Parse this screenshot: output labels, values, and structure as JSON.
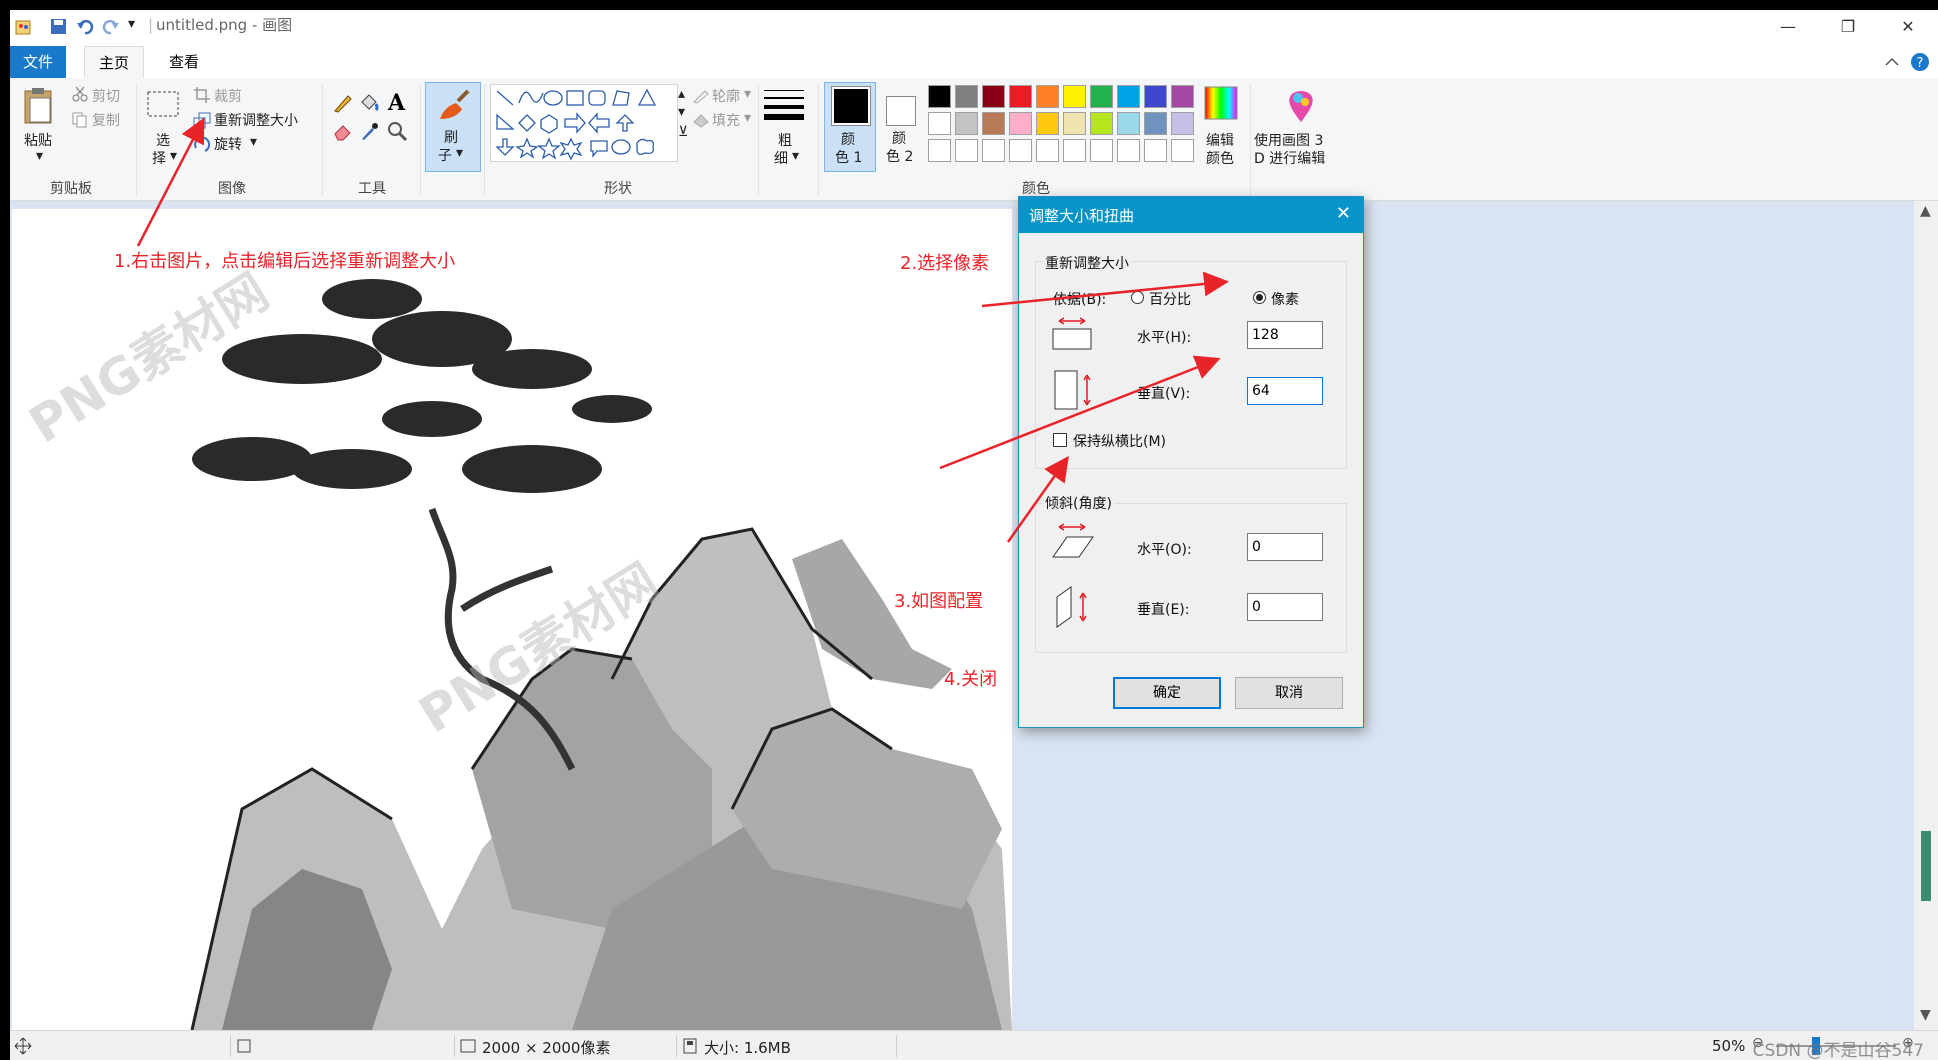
{
  "titlebar": {
    "title": "untitled.png - 画图",
    "qat_dropdown": "▾",
    "minimize": "—",
    "restore": "❐",
    "close": "✕"
  },
  "tabs": {
    "file": "文件",
    "home": "主页",
    "view": "查看"
  },
  "ribbon": {
    "clipboard": {
      "paste": "粘贴",
      "cut": "剪切",
      "copy": "复制",
      "label": "剪贴板"
    },
    "image": {
      "select_line1": "选",
      "select_line2": "择",
      "crop": "裁剪",
      "resize": "重新调整大小",
      "rotate": "旋转",
      "label": "图像"
    },
    "tools": {
      "label": "工具"
    },
    "brushes": {
      "line1": "刷",
      "line2": "子"
    },
    "shapes": {
      "outline": "轮廓",
      "fill": "填充",
      "label": "形状"
    },
    "size": {
      "line1": "粗",
      "line2": "细"
    },
    "color1": {
      "line1": "颜",
      "line2": "色 1"
    },
    "color2": {
      "line1": "颜",
      "line2": "色 2"
    },
    "colors_label": "颜色",
    "edit_colors": {
      "line1": "编辑",
      "line2": "颜色"
    },
    "paint3d": {
      "line1": "使用画图 3",
      "line2": "D 进行编辑"
    },
    "palette_row1": [
      "#000000",
      "#7f7f7f",
      "#880015",
      "#ed1c24",
      "#ff7f27",
      "#fff200",
      "#22b14c",
      "#00a2e8",
      "#3f48cc",
      "#a349a4"
    ],
    "palette_row2": [
      "#ffffff",
      "#c3c3c3",
      "#b97a57",
      "#ffaec9",
      "#ffc90e",
      "#efe4b0",
      "#b5e61d",
      "#99d9ea",
      "#7092be",
      "#c8bfe7"
    ],
    "palette_row3": [
      "#ffffff",
      "#ffffff",
      "#ffffff",
      "#ffffff",
      "#ffffff",
      "#ffffff",
      "#ffffff",
      "#ffffff",
      "#ffffff",
      "#ffffff"
    ]
  },
  "dialog": {
    "title": "调整大小和扭曲",
    "resize_group": "重新调整大小",
    "by_label": "依据(B):",
    "percent": "百分比",
    "pixels": "像素",
    "horizontal_label": "水平(H):",
    "horizontal_value": "128",
    "vertical_label": "垂直(V):",
    "vertical_value": "64",
    "keep_ratio": "保持纵横比(M)",
    "skew_group": "倾斜(角度)",
    "skew_h_label": "水平(O):",
    "skew_h_value": "0",
    "skew_v_label": "垂直(E):",
    "skew_v_value": "0",
    "ok": "确定",
    "cancel": "取消"
  },
  "annotations": {
    "step1": "1.右击图片，点击编辑后选择重新调整大小",
    "step2": "2.选择像素",
    "step3": "3.如图配置",
    "step4": "4.关闭"
  },
  "watermark": "PNG素材网",
  "statusbar": {
    "dimensions": "2000 × 2000像素",
    "size": "大小: 1.6MB",
    "zoom": "50%",
    "credit": "CSDN @不是山谷547"
  }
}
